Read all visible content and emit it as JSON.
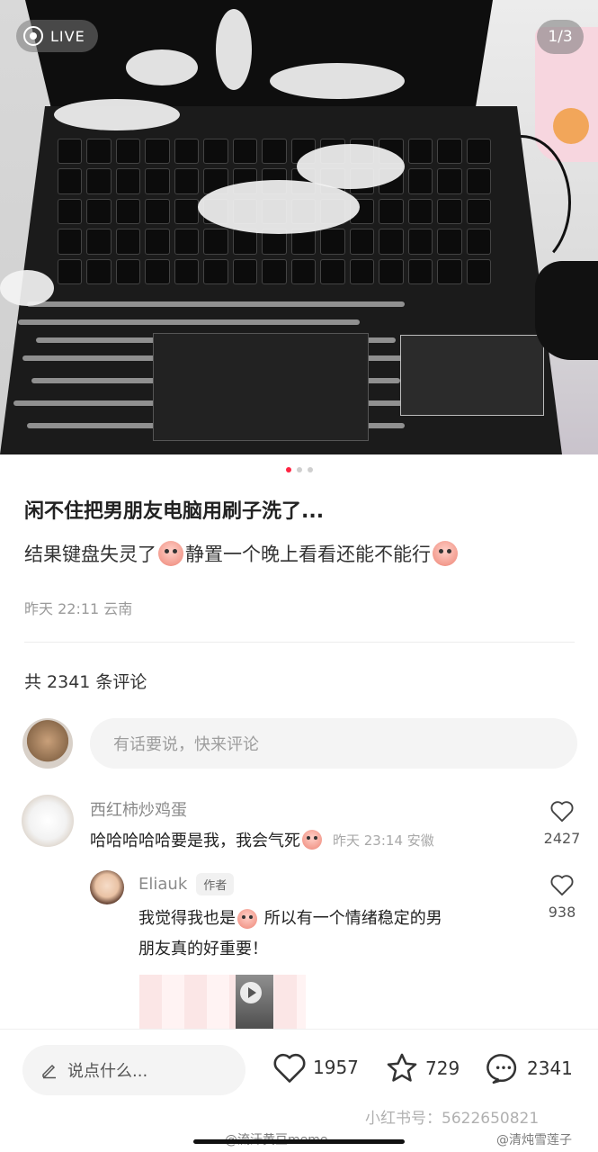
{
  "media": {
    "live_label": "LIVE",
    "page_indicator": "1/3",
    "dots_total": 3,
    "dots_active": 1
  },
  "post": {
    "title": "闲不住把男朋友电脑用刷子洗了...",
    "body_part1": "结果键盘失灵了",
    "body_part2": "静置一个晚上看看还能不能行",
    "meta": "昨天 22:11 云南"
  },
  "comments_section": {
    "count_label": "共 2341 条评论",
    "input_placeholder": "有话要说，快来评论"
  },
  "comments": [
    {
      "author": "西红柿炒鸡蛋",
      "text": "哈哈哈哈哈要是我，我会气死",
      "meta": "昨天 23:14 安徽",
      "likes": "2427"
    },
    {
      "author": "Eliauk",
      "badge": "作者",
      "text_line1_a": "我觉得我也是",
      "text_line1_b": " 所以有一个情绪稳定的男",
      "text_line2": "朋友真的好重要！",
      "likes": "938"
    }
  ],
  "bottom_bar": {
    "input_placeholder": "说点什么...",
    "like_count": "1957",
    "star_count": "729",
    "comment_count": "2341"
  },
  "watermarks": {
    "id_text": "小红书号：5622650821",
    "weibo_left": "@流汗黄豆meme",
    "weibo_right": "@清炖雪莲子"
  },
  "colors": {
    "accent": "#ff2442",
    "text_primary": "#222222",
    "text_secondary": "#9a9a9a"
  }
}
